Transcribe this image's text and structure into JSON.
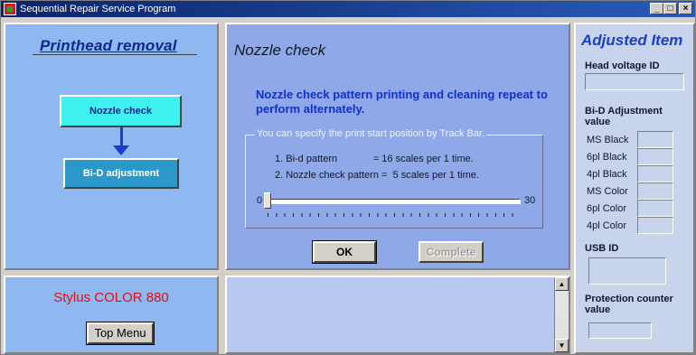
{
  "window": {
    "title": "Sequential Repair Service Program",
    "controls": {
      "minimize": "_",
      "maximize": "□",
      "close": "×"
    }
  },
  "left_panel": {
    "title": "Printhead removal",
    "steps": [
      {
        "label": "Nozzle check",
        "active": true
      },
      {
        "label": "Bi-D adjustment",
        "active": false
      }
    ]
  },
  "nozzle_panel": {
    "title": "Nozzle check",
    "description": "Nozzle check pattern printing and cleaning repeat to perform alternately.",
    "group_label": "You can specify the print start position by Track Bar.",
    "patterns": [
      "1. Bi-d pattern             = 16 scales per 1 time.",
      "2. Nozzle check pattern =  5 scales per 1 time."
    ],
    "slider": {
      "min": "0",
      "max": "30",
      "value": 0
    },
    "ok_label": "OK",
    "complete_label": "Complete"
  },
  "model_panel": {
    "model_name": "Stylus COLOR 880",
    "top_menu_label": "Top Menu"
  },
  "log": {
    "text": ""
  },
  "adjusted": {
    "title": "Adjusted Item",
    "head_voltage_label": "Head voltage ID",
    "head_voltage_value": "",
    "bid_label": "Bi-D Adjustment value",
    "bid_rows": [
      {
        "label": "MS Black",
        "value": ""
      },
      {
        "label": "6pl Black",
        "value": ""
      },
      {
        "label": "4pl Black",
        "value": ""
      },
      {
        "label": "MS Color",
        "value": ""
      },
      {
        "label": "6pl Color",
        "value": ""
      },
      {
        "label": "4pl Color",
        "value": ""
      }
    ],
    "usb_label": "USB ID",
    "usb_value": "",
    "protection_label": "Protection counter value",
    "protection_value": ""
  }
}
